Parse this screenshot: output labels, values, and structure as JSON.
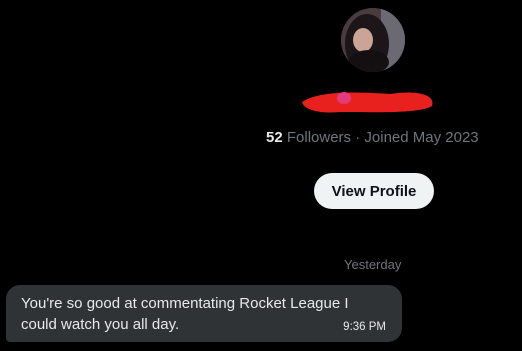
{
  "profile": {
    "avatar_icon": "profile-photo",
    "display_name_redacted": true,
    "followers_count": "52",
    "followers_label": "Followers",
    "separator": " · ",
    "joined_text": "Joined May 2023",
    "view_profile_label": "View Profile"
  },
  "conversation": {
    "day_divider": "Yesterday",
    "messages": [
      {
        "text": "You're so good at commentating Rocket League I could watch you all day.",
        "time": "9:36 PM"
      }
    ]
  },
  "colors": {
    "background": "#000000",
    "muted_text": "#71767b",
    "primary_text": "#e7e9ea",
    "bubble": "#2f3336",
    "button_bg": "#eff3f4",
    "redaction": "#e8211f"
  }
}
